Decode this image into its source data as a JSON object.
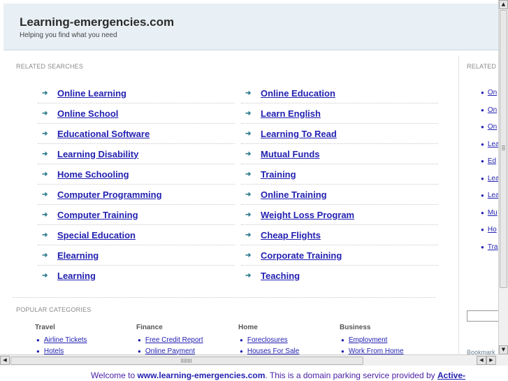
{
  "header": {
    "title": "Learning-emergencies.com",
    "tagline": "Helping you find what you need"
  },
  "related_searches": {
    "heading": "RELATED SEARCHES",
    "left": [
      "Online Learning",
      "Online School",
      "Educational Software",
      "Learning Disability",
      "Home Schooling",
      "Computer Programming",
      "Computer Training",
      "Special Education",
      "Elearning",
      "Learning"
    ],
    "right": [
      "Online Education",
      "Learn English",
      "Learning To Read",
      "Mutual Funds",
      "Training",
      "Online Training",
      "Weight Loss Program",
      "Cheap Flights",
      "Corporate Training",
      "Teaching"
    ]
  },
  "popular": {
    "heading": "POPULAR CATEGORIES",
    "categories": [
      {
        "title": "Travel",
        "links": [
          "Airline Tickets",
          "Hotels"
        ]
      },
      {
        "title": "Finance",
        "links": [
          "Free Credit Report",
          "Online Payment"
        ]
      },
      {
        "title": "Home",
        "links": [
          "Foreclosures",
          "Houses For Sale"
        ]
      },
      {
        "title": "Business",
        "links": [
          "Employment",
          "Work From Home"
        ]
      }
    ]
  },
  "sidebar": {
    "heading": "RELATED",
    "items": [
      "On",
      "On",
      "On",
      "Lea",
      "Ed",
      "Lea",
      "Lea",
      "Mu",
      "Ho",
      "Tra"
    ],
    "bookmark": "Bookmark"
  },
  "footer": {
    "prefix": "Welcome to ",
    "domain": "www.learning-emergencies.com",
    "middle": ". This is a domain parking service provided by ",
    "provider": "Active-"
  },
  "colors": {
    "header_bg": "#e8f0f5",
    "link": "#2321b1",
    "arrow": "#2f7c8e"
  }
}
